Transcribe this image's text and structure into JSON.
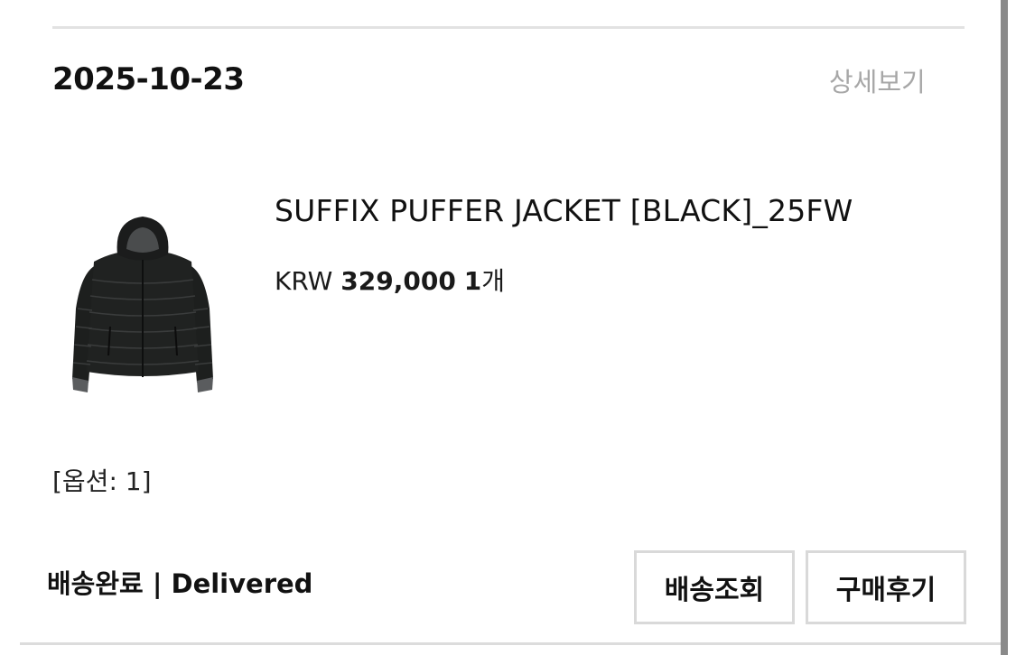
{
  "order": {
    "date": "2025-10-23",
    "detail_link": "상세보기"
  },
  "product": {
    "name": "SUFFIX PUFFER JACKET [BLACK]_25FW",
    "currency": "KRW",
    "price": "329,000",
    "quantity": "1",
    "quantity_unit": "개",
    "image_icon": "black-puffer-jacket-image",
    "option": "[옵션: 1]"
  },
  "status": {
    "label": "배송완료 | Delivered"
  },
  "actions": {
    "track_label": "배송조회",
    "review_label": "구매후기"
  }
}
